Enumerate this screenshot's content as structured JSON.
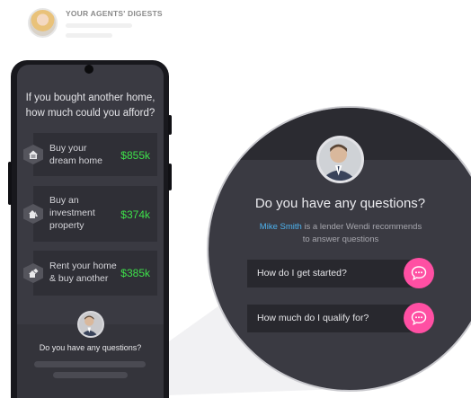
{
  "header": {
    "title": "YOUR AGENTS' DIGESTS"
  },
  "phone": {
    "question": "If you bought another home, how much could you afford?",
    "options": [
      {
        "icon": "house-icon",
        "label_line1": "Buy your",
        "label_line2": "dream home",
        "label_line3": "",
        "amount": "$855k"
      },
      {
        "icon": "investment-house-icon",
        "label_line1": "Buy an",
        "label_line2": "investment",
        "label_line3": "property",
        "amount": "$374k"
      },
      {
        "icon": "rent-house-icon",
        "label_line1": "Rent your home",
        "label_line2": "& buy another",
        "label_line3": "",
        "amount": "$385k"
      }
    ],
    "footer_question": "Do you have any questions?"
  },
  "zoom": {
    "question": "Do you have any questions?",
    "lender_name": "Mike Smith",
    "lender_text_1": " is a lender Wendi recommends",
    "lender_text_2": "to answer questions",
    "faqs": [
      {
        "label": "How do I get started?"
      },
      {
        "label": "How much do I qualify for?"
      }
    ]
  },
  "colors": {
    "accent_green": "#3ee04a",
    "chat_pink": "#ff4fa3",
    "link_blue": "#4db3f0",
    "screen_bg": "#3a3a42"
  }
}
